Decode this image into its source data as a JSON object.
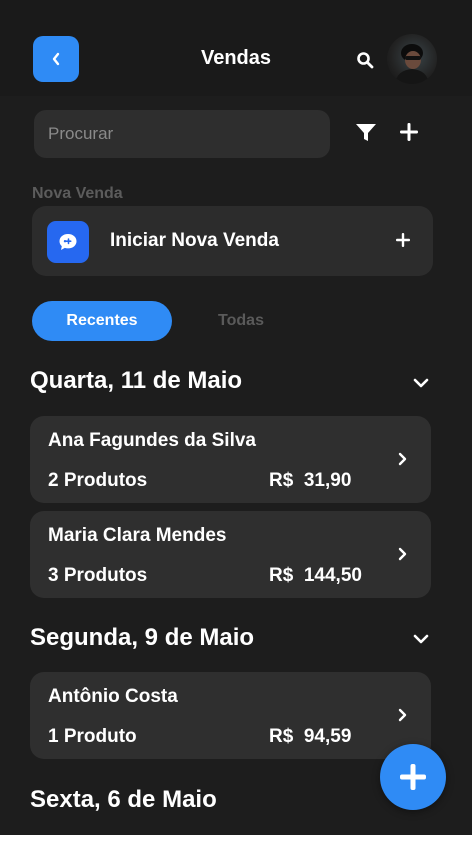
{
  "header": {
    "title": "Vendas",
    "back_icon": "chevron-left-icon",
    "search_icon": "search-icon",
    "avatar": "user-avatar"
  },
  "search": {
    "placeholder": "Procurar",
    "value": ""
  },
  "toolbar": {
    "filter_icon": "filter-icon",
    "add_icon": "plus-icon"
  },
  "new_sale": {
    "section_label": "Nova Venda",
    "label": "Iniciar Nova Venda",
    "icon": "chat-bubble-icon",
    "action_icon": "plus-icon"
  },
  "tabs": [
    {
      "label": "Recentes",
      "active": true
    },
    {
      "label": "Todas",
      "active": false
    }
  ],
  "groups": [
    {
      "date": "Quarta, 11 de Maio",
      "sales": [
        {
          "name": "Ana Fagundes da Silva",
          "products": "2 Produtos",
          "price": "R$  31,90"
        },
        {
          "name": "Maria Clara Mendes",
          "products": "3 Produtos",
          "price": "R$  144,50"
        }
      ]
    },
    {
      "date": "Segunda, 9 de Maio",
      "sales": [
        {
          "name": "Antônio Costa",
          "products": "1 Produto",
          "price": "R$  94,59"
        }
      ]
    },
    {
      "date": "Sexta, 6 de Maio",
      "sales": []
    }
  ],
  "fab": {
    "icon": "plus-icon"
  },
  "colors": {
    "background": "#1d1d1d",
    "card": "#2f2f2f",
    "accent": "#2f8bf5",
    "new_sale_icon": "#2668f0",
    "muted": "#5c5c5c"
  }
}
